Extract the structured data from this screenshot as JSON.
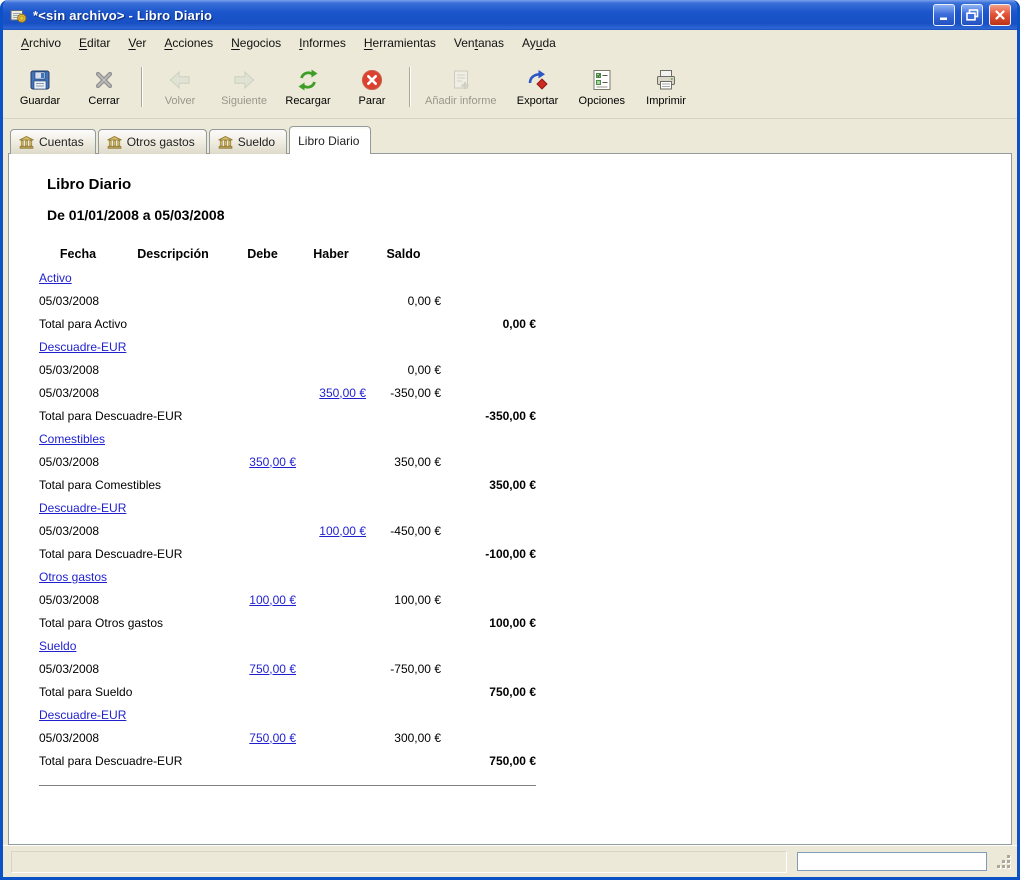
{
  "palette": {
    "link": "#1F1FD0",
    "chrome_bg": "#ECE9D8",
    "titlebar_blue": "#1C56CC",
    "report_bg": "#FFFFFF",
    "close_red": "#E3553A"
  },
  "window": {
    "title": "*<sin archivo> - Libro Diario",
    "controls": [
      {
        "name": "minimize",
        "glyph": "minimize-icon"
      },
      {
        "name": "restore",
        "glyph": "restore-icon"
      },
      {
        "name": "close",
        "glyph": "close-icon"
      }
    ]
  },
  "menubar": {
    "items": [
      {
        "label": "Archivo",
        "accel": 0
      },
      {
        "label": "Editar",
        "accel": 0
      },
      {
        "label": "Ver",
        "accel": 0
      },
      {
        "label": "Acciones",
        "accel": 0
      },
      {
        "label": "Negocios",
        "accel": 0
      },
      {
        "label": "Informes",
        "accel": 0
      },
      {
        "label": "Herramientas",
        "accel": 0
      },
      {
        "label": "Ventanas",
        "accel": 3
      },
      {
        "label": "Ayuda",
        "accel": 2
      }
    ]
  },
  "toolbar": {
    "buttons": [
      {
        "label": "Guardar",
        "icon": "save-icon",
        "enabled": true
      },
      {
        "label": "Cerrar",
        "icon": "close-file-icon",
        "enabled": true
      },
      {
        "type": "separator"
      },
      {
        "label": "Volver",
        "icon": "back-icon",
        "enabled": false
      },
      {
        "label": "Siguiente",
        "icon": "forward-icon",
        "enabled": false
      },
      {
        "label": "Recargar",
        "icon": "reload-icon",
        "enabled": true
      },
      {
        "label": "Parar",
        "icon": "stop-icon",
        "enabled": true
      },
      {
        "type": "separator"
      },
      {
        "label": "Añadir informe",
        "icon": "add-report-icon",
        "enabled": false
      },
      {
        "label": "Exportar",
        "icon": "export-icon",
        "enabled": true
      },
      {
        "label": "Opciones",
        "icon": "options-icon",
        "enabled": true
      },
      {
        "label": "Imprimir",
        "icon": "print-icon",
        "enabled": true
      }
    ]
  },
  "tabs": [
    {
      "label": "Cuentas",
      "icon": "account-icon",
      "active": false
    },
    {
      "label": "Otros gastos",
      "icon": "account-icon",
      "active": false
    },
    {
      "label": "Sueldo",
      "icon": "account-icon",
      "active": false
    },
    {
      "label": "Libro Diario",
      "icon": null,
      "active": true
    }
  ],
  "report": {
    "title": "Libro Diario",
    "subtitle": "De 01/01/2008 a 05/03/2008",
    "columns": [
      "Fecha",
      "Descripción",
      "Debe",
      "Haber",
      "Saldo"
    ],
    "rows": [
      {
        "type": "account",
        "label": "Activo"
      },
      {
        "type": "entry",
        "fecha": "05/03/2008",
        "debe": "",
        "haber": "",
        "saldo": "0,00 €"
      },
      {
        "type": "total",
        "label": "Total para Activo",
        "total": "0,00 €"
      },
      {
        "type": "account",
        "label": "Descuadre-EUR"
      },
      {
        "type": "entry",
        "fecha": "05/03/2008",
        "debe": "",
        "haber": "",
        "saldo": "0,00 €"
      },
      {
        "type": "entry",
        "fecha": "05/03/2008",
        "debe": "",
        "haber": "350,00 €",
        "haber_link": true,
        "saldo": "-350,00 €"
      },
      {
        "type": "total",
        "label": "Total para Descuadre-EUR",
        "total": "-350,00 €"
      },
      {
        "type": "account",
        "label": "Comestibles"
      },
      {
        "type": "entry",
        "fecha": "05/03/2008",
        "debe": "350,00 €",
        "debe_link": true,
        "haber": "",
        "saldo": "350,00 €"
      },
      {
        "type": "total",
        "label": "Total para Comestibles",
        "total": "350,00 €"
      },
      {
        "type": "account",
        "label": "Descuadre-EUR"
      },
      {
        "type": "entry",
        "fecha": "05/03/2008",
        "debe": "",
        "haber": "100,00 €",
        "haber_link": true,
        "saldo": "-450,00 €"
      },
      {
        "type": "total",
        "label": "Total para Descuadre-EUR",
        "total": "-100,00 €"
      },
      {
        "type": "account",
        "label": "Otros gastos"
      },
      {
        "type": "entry",
        "fecha": "05/03/2008",
        "debe": "100,00 €",
        "debe_link": true,
        "haber": "",
        "saldo": "100,00 €"
      },
      {
        "type": "total",
        "label": "Total para Otros gastos",
        "total": "100,00 €"
      },
      {
        "type": "account",
        "label": "Sueldo"
      },
      {
        "type": "entry",
        "fecha": "05/03/2008",
        "debe": "750,00 €",
        "debe_link": true,
        "haber": "",
        "saldo": "-750,00 €"
      },
      {
        "type": "total",
        "label": "Total para Sueldo",
        "total": "750,00 €"
      },
      {
        "type": "account",
        "label": "Descuadre-EUR"
      },
      {
        "type": "entry",
        "fecha": "05/03/2008",
        "debe": "750,00 €",
        "debe_link": true,
        "haber": "",
        "saldo": "300,00 €"
      },
      {
        "type": "total",
        "label": "Total para Descuadre-EUR",
        "total": "750,00 €"
      }
    ]
  }
}
